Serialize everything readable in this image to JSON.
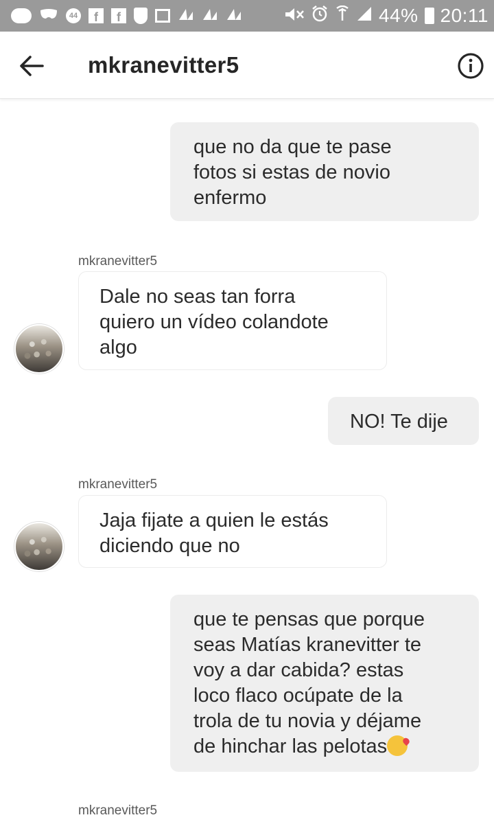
{
  "status_bar": {
    "battery": "44%",
    "time": "20:11",
    "notification_badge": "44",
    "icons": [
      "chat-icon",
      "mask-icon",
      "badge-icon",
      "facebook-icon",
      "facebook-icon",
      "shield-icon",
      "image-icon",
      "signal-icon",
      "signal-icon",
      "signal-icon",
      "mute-icon",
      "alarm-icon",
      "wifi-icon",
      "cell-signal-icon",
      "battery-icon"
    ]
  },
  "header": {
    "title": "mkranevitter5",
    "back_icon": "arrow-left-icon",
    "info_icon": "info-icon"
  },
  "messages": [
    {
      "direction": "outgoing",
      "lines": [
        "que no da que te pase",
        "fotos si estas de novio",
        "enfermo"
      ]
    },
    {
      "direction": "incoming",
      "sender": "mkranevitter5",
      "lines": [
        "Dale no seas tan forra",
        "quiero un vídeo colandote",
        "algo"
      ]
    },
    {
      "direction": "outgoing",
      "lines": [
        "NO! Te dije"
      ]
    },
    {
      "direction": "incoming",
      "sender": "mkranevitter5",
      "lines": [
        "Jaja fijate a quien le estás",
        "diciendo que no"
      ]
    },
    {
      "direction": "outgoing",
      "lines": [
        "que te pensas que porque",
        "seas Matías kranevitter te",
        "voy a dar cabida? estas",
        "loco flaco ocúpate de la",
        "trola de tu novia y déjame",
        "de hinchar las pelotas"
      ],
      "emoji": "kissing-heart-emoji"
    },
    {
      "direction": "incoming",
      "sender": "mkranevitter5"
    }
  ],
  "colors": {
    "status_bar_bg": "#9a9a9a",
    "outgoing_bubble": "#efefef",
    "incoming_bubble": "#ffffff",
    "text": "#262626"
  }
}
